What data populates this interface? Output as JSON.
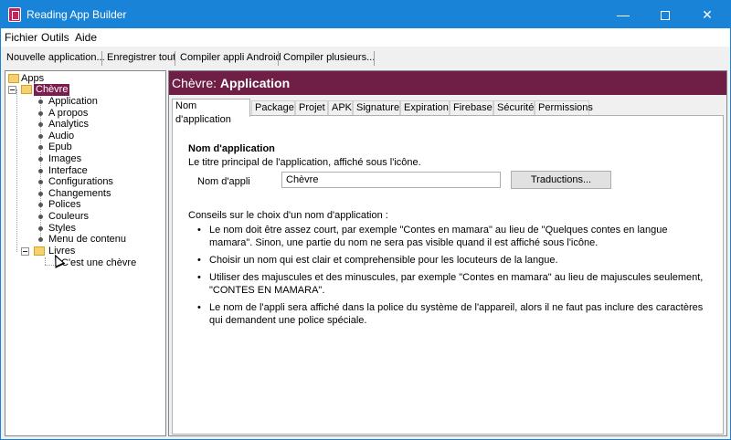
{
  "window": {
    "title": "Reading App Builder",
    "controls": {
      "minimize": "—",
      "close": "✕"
    }
  },
  "menu": [
    "Fichier",
    "Outils",
    "Aide"
  ],
  "toolbar": {
    "new_app": "Nouvelle application...",
    "save_all": "Enregistrer tout",
    "compile_android": "Compiler appli Android",
    "compile_multiple": "Compiler plusieurs..."
  },
  "tree": {
    "root": "Apps",
    "app": "Chèvre",
    "app_items": [
      "Application",
      "A propos",
      "Analytics",
      "Audio",
      "Epub",
      "Images",
      "Interface",
      "Configurations",
      "Changements",
      "Polices",
      "Couleurs",
      "Styles",
      "Menu de contenu"
    ],
    "books_folder": "Livres",
    "book": "C'est une chèvre"
  },
  "panel": {
    "header_prefix": "Chèvre:",
    "header_title": "Application",
    "tabs": [
      "Nom d'application",
      "Package",
      "Projet",
      "APK",
      "Signature",
      "Expiration",
      "Firebase",
      "Sécurité",
      "Permissions"
    ],
    "section_title": "Nom d'application",
    "section_desc": "Le titre principal de l'application, affiché sous l'icône.",
    "field_label": "Nom d'appli",
    "field_value": "Chèvre",
    "translations_button": "Traductions...",
    "advice_title": "Conseils sur le choix d'un nom d'application :",
    "advice": [
      "Le nom doit être assez court, par exemple \"Contes en mamara\" au lieu de \"Quelques contes en langue mamara\". Sinon, une partie du nom ne sera pas visible quand il est affiché sous l'icône.",
      "Choisir un nom qui est clair et comprehensible pour les locuteurs de la langue.",
      "Utiliser des majuscules et des minuscules, par exemple \"Contes en mamara\" au lieu de majuscules seulement, \"CONTES EN MAMARA\".",
      "Le nom de l'appli sera affiché dans la police du système de l'appareil, alors il ne faut pas inclure des caractères qui demandent une police spéciale."
    ]
  },
  "colors": {
    "titlebar": "#1883d7",
    "header": "#6f1e45",
    "selection": "#7a1e4d"
  }
}
